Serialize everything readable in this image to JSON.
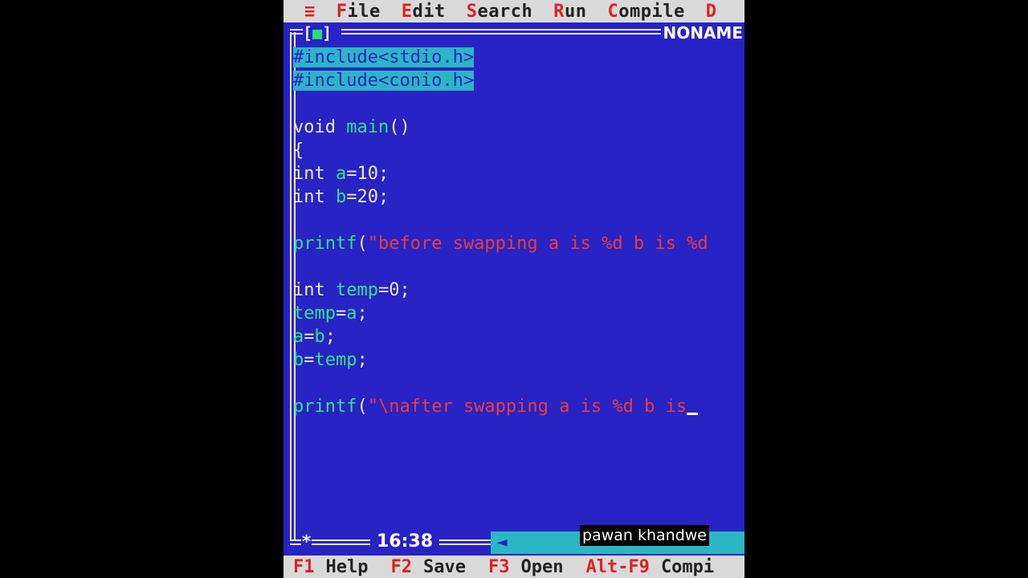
{
  "menu": {
    "system": "≡",
    "items": [
      {
        "hot": "F",
        "rest": "ile"
      },
      {
        "hot": "E",
        "rest": "dit"
      },
      {
        "hot": "S",
        "rest": "earch"
      },
      {
        "hot": "R",
        "rest": "un"
      },
      {
        "hot": "C",
        "rest": "ompile"
      },
      {
        "hot": "D",
        "rest": ""
      }
    ]
  },
  "window": {
    "close_left": "[",
    "close_box": "■",
    "close_right": "]",
    "filename": "NONAME"
  },
  "code": {
    "l1": "#include<stdio.h>",
    "l2": "#include<conio.h>",
    "l4a": "void ",
    "l4b": "main",
    "l4c": "()",
    "l5": "{",
    "l6a": "int ",
    "l6b": "a",
    "l6c": "=10;",
    "l7a": "int ",
    "l7b": "b",
    "l7c": "=20;",
    "l9a": "printf",
    "l9b": "(",
    "l9c": "\"before swapping a is %d b is %d",
    "l11a": "int ",
    "l11b": "temp",
    "l11c": "=0;",
    "l12a": "temp",
    "l12b": "=",
    "l12c": "a",
    "l12d": ";",
    "l13a": "a",
    "l13b": "=",
    "l13c": "b",
    "l13d": ";",
    "l14a": "b",
    "l14b": "=",
    "l14c": "temp",
    "l14d": ";",
    "l16a": "printf",
    "l16b": "(",
    "l16c": "\"\\nafter swapping a is %d b is"
  },
  "cursor_pos": "16:38",
  "frame_star": "*",
  "scroll_icon": "◄",
  "watermark": "pawan khandwe",
  "status": [
    {
      "key": "F1",
      "label": "Help"
    },
    {
      "key": "F2",
      "label": "Save"
    },
    {
      "key": "F3",
      "label": "Open"
    },
    {
      "key": "Alt-F9",
      "label": "Compi"
    }
  ]
}
